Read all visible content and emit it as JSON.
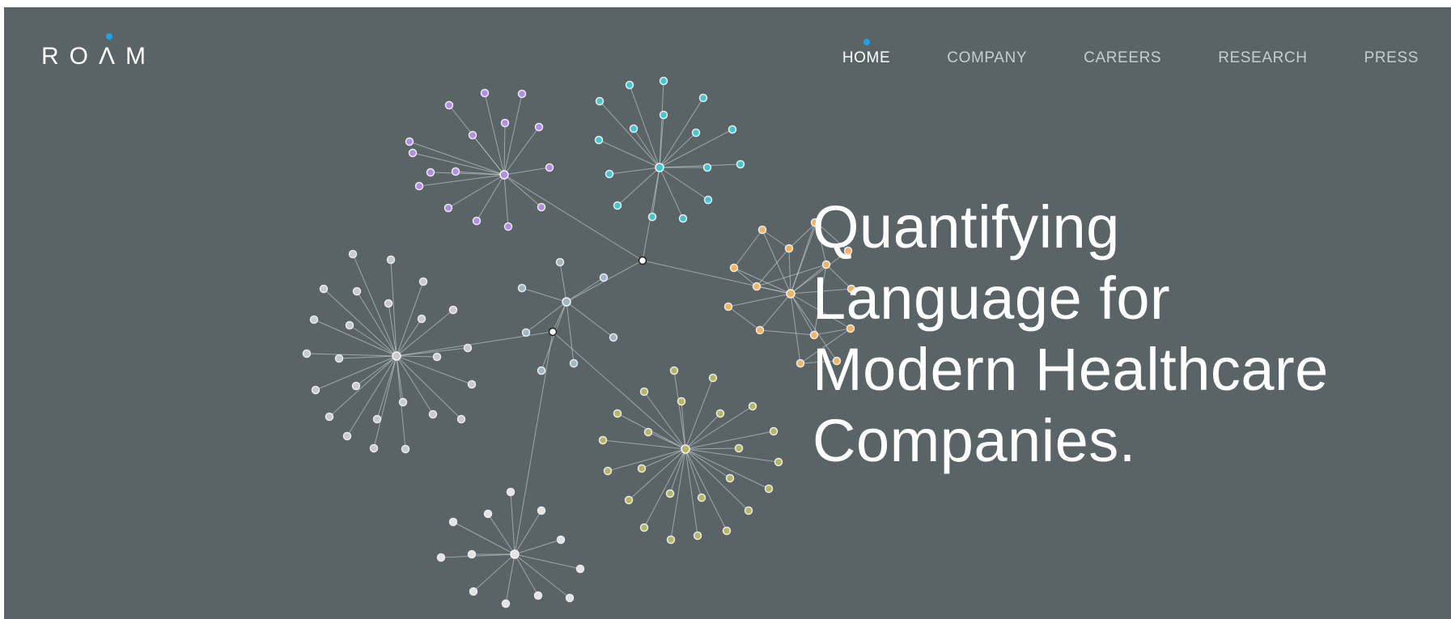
{
  "brand": {
    "logo_text": "ROΛM",
    "accent_color": "#1aa3e8"
  },
  "nav": {
    "items": [
      {
        "label": "HOME",
        "active": true
      },
      {
        "label": "COMPANY",
        "active": false
      },
      {
        "label": "CAREERS",
        "active": false
      },
      {
        "label": "RESEARCH",
        "active": false
      },
      {
        "label": "PRESS",
        "active": false
      }
    ]
  },
  "hero": {
    "headline_lines": [
      "Quantifying",
      "Language for",
      "Modern Healthcare",
      "Companies."
    ]
  },
  "theme": {
    "background": "#5a6466",
    "cluster_colors": {
      "purple": "#b48ce6",
      "teal": "#43c6d0",
      "orange": "#f6b35e",
      "gray": "#c9cacc",
      "blue": "#9fb6c7",
      "olive": "#b8b55f",
      "white": "#e4e4e4"
    }
  }
}
